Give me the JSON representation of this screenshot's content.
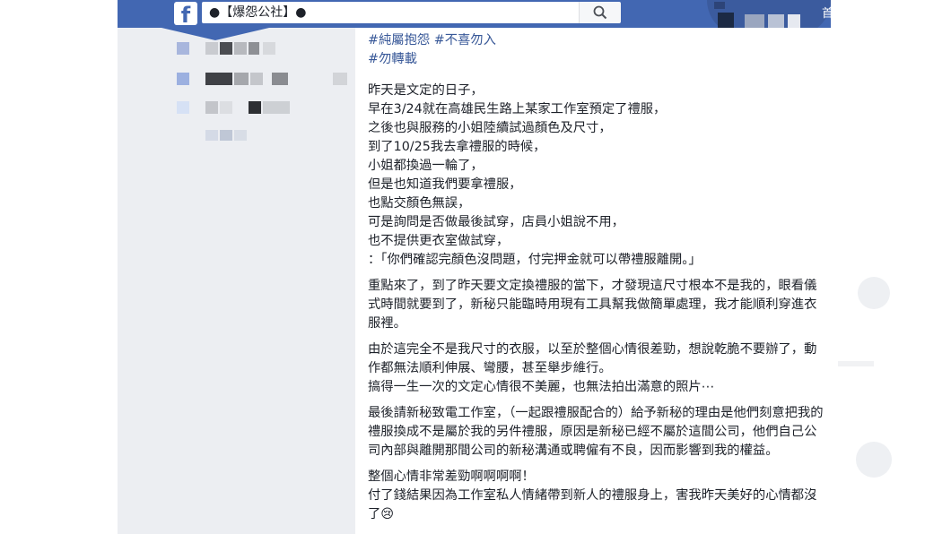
{
  "header": {
    "logo": "f",
    "search_value": "●【爆怨公社】●",
    "home_label": "首"
  },
  "icons": {
    "logo": "facebook-logo-icon",
    "search": "search-icon"
  },
  "colors": {
    "facebook_blue": "#4267b2",
    "hashtag": "#385898",
    "text": "#1d2129"
  },
  "post": {
    "hashtags": [
      "#純屬抱怨 #不喜勿入",
      "#勿轉載"
    ],
    "story_lines": [
      "昨天是文定的日子，",
      "早在3/24就在高雄民生路上某家工作室預定了禮服，",
      "之後也與服務的小姐陸續試過顏色及尺寸，",
      "到了10/25我去拿禮服的時候，",
      "小姐都換過一輪了，",
      "但是也知道我們要拿禮服，",
      "也點交顏色無誤，",
      "可是詢問是否做最後試穿，店員小姐說不用，",
      "也不提供更衣室做試穿，",
      "：「你們確認完顏色沒問題，付完押金就可以帶禮服離開。」"
    ],
    "paragraphs": [
      "重點來了，到了昨天要文定換禮服的當下，才發現這尺寸根本不是我的，眼看儀式時間就要到了，新秘只能臨時用現有工具幫我做簡單處理，我才能順利穿進衣服裡。",
      "由於這完全不是我尺寸的衣服，以至於整個心情很差勁，想說乾脆不要辦了，動作都無法順利伸展、彎腰，甚至舉步維行。",
      "搞得一生一次的文定心情很不美麗，也無法拍出滿意的照片⋯",
      "最後請新秘致電工作室，（一起跟禮服配合的）給予新秘的理由是他們刻意把我的禮服換成不是屬於我的另件禮服，原因是新秘已經不屬於這間公司，他們自己公司內部與離開那間公司的新秘溝通或聘僱有不良，因而影響到我的權益。",
      "整個心情非常差勁啊啊啊啊！",
      "付了錢結果因為工作室私人情緒帶到新人的禮服身上，害我昨天美好的心情都沒了😢"
    ]
  }
}
